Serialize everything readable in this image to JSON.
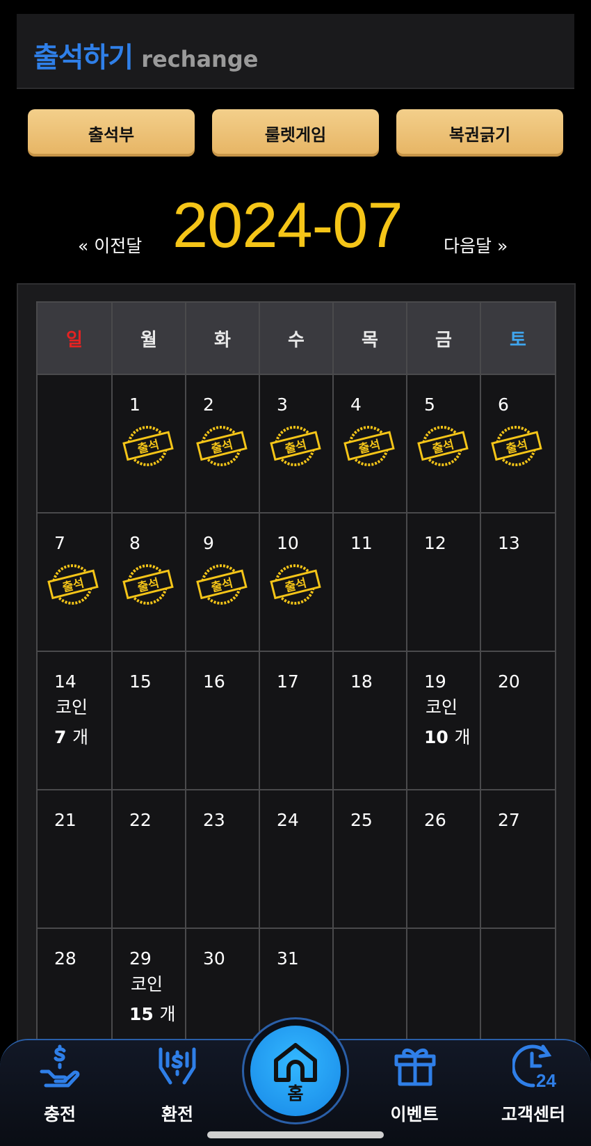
{
  "header": {
    "title": "출석하기",
    "subtitle": "rechange"
  },
  "tabs": [
    {
      "label": "출석부"
    },
    {
      "label": "룰렛게임"
    },
    {
      "label": "복권긁기"
    }
  ],
  "month_nav": {
    "prev": "« 이전달",
    "current": "2024-07",
    "next": "다음달 »"
  },
  "calendar": {
    "weekdays": [
      "일",
      "월",
      "화",
      "수",
      "목",
      "금",
      "토"
    ],
    "stamp_text": "출석",
    "coin_label": "코인",
    "coin_unit": "개",
    "weeks": [
      [
        {
          "day": ""
        },
        {
          "day": "1",
          "stamp": true
        },
        {
          "day": "2",
          "stamp": true
        },
        {
          "day": "3",
          "stamp": true
        },
        {
          "day": "4",
          "stamp": true
        },
        {
          "day": "5",
          "stamp": true
        },
        {
          "day": "6",
          "stamp": true
        }
      ],
      [
        {
          "day": "7",
          "stamp": true
        },
        {
          "day": "8",
          "stamp": true
        },
        {
          "day": "9",
          "stamp": true
        },
        {
          "day": "10",
          "stamp": true
        },
        {
          "day": "11"
        },
        {
          "day": "12"
        },
        {
          "day": "13"
        }
      ],
      [
        {
          "day": "14",
          "coins": "7"
        },
        {
          "day": "15"
        },
        {
          "day": "16"
        },
        {
          "day": "17"
        },
        {
          "day": "18"
        },
        {
          "day": "19",
          "coins": "10"
        },
        {
          "day": "20"
        }
      ],
      [
        {
          "day": "21"
        },
        {
          "day": "22"
        },
        {
          "day": "23"
        },
        {
          "day": "24"
        },
        {
          "day": "25"
        },
        {
          "day": "26"
        },
        {
          "day": "27"
        }
      ],
      [
        {
          "day": "28"
        },
        {
          "day": "29",
          "coins": "15"
        },
        {
          "day": "30"
        },
        {
          "day": "31"
        },
        {
          "day": ""
        },
        {
          "day": ""
        },
        {
          "day": ""
        }
      ]
    ]
  },
  "bottom_nav": {
    "items": [
      {
        "label": "충전",
        "icon": "charge-icon"
      },
      {
        "label": "환전",
        "icon": "exchange-icon"
      },
      {
        "label": "홈",
        "icon": "home-icon"
      },
      {
        "label": "이벤트",
        "icon": "gift-icon"
      },
      {
        "label": "고객센터",
        "icon": "support-24-icon"
      }
    ]
  },
  "colors": {
    "accent_blue": "#2f7fe8",
    "gold": "#f5c518",
    "tab_gold": "#eec176",
    "sunday": "#e52222",
    "saturday": "#3fa6ef"
  }
}
